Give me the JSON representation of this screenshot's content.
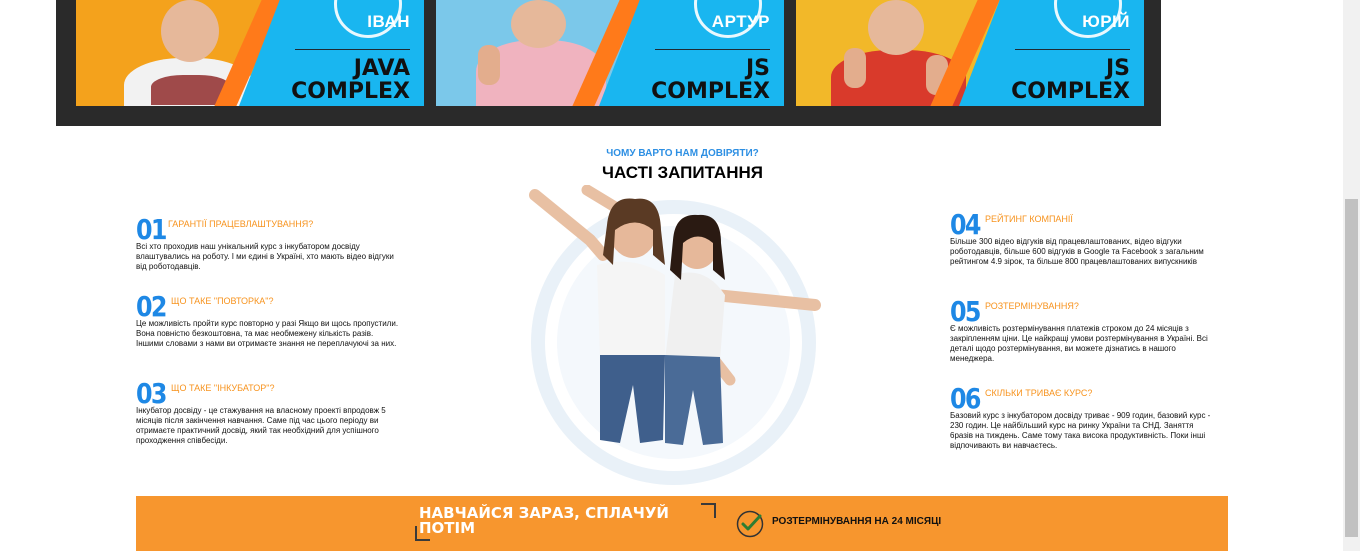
{
  "videos": [
    {
      "name": "ІВАН",
      "course_line1": "JAVA",
      "course_line2": "COMPLEX"
    },
    {
      "name": "АРТУР",
      "course_line1": "JS",
      "course_line2": "COMPLEX"
    },
    {
      "name": "ЮРІЙ",
      "course_line1": "JS",
      "course_line2": "COMPLEX"
    }
  ],
  "section": {
    "kicker": "ЧОМУ ВАРТО НАМ ДОВІРЯТИ?",
    "title": "ЧАСТІ ЗАПИТАННЯ"
  },
  "faq": [
    {
      "num": "01",
      "question": "ГАРАНТІЇ ПРАЦЕВЛАШТУВАННЯ?",
      "answer": "Всі хто проходив наш унікальний курс з інкубатором досвіду влаштувались на роботу. І ми єдині в Україні, хто мають відео відгуки від роботодавців."
    },
    {
      "num": "02",
      "question": "ЩО ТАКЕ \"ПОВТОРКА\"?",
      "answer": "Це можливість пройти курс повторно у разі Якщо ви щось пропустили. Вона повністю безкоштовна, та має необмежену кількість разів. Іншими словами з нами ви отримаєте знання не переплачуючі за них."
    },
    {
      "num": "03",
      "question": "ЩО ТАКЕ \"ІНКУБАТОР\"?",
      "answer": "Інкубатор досвіду - це стажування на власному проекті впродовж 5 місяців після закінчення навчання. Саме під час цього періоду ви отримаєте практичний досвід, який так необхідний для успішного проходження співбесіди."
    },
    {
      "num": "04",
      "question": "РЕЙТИНГ КОМПАНІЇ",
      "answer": "Більше 300 відео відгуків від працевлаштованих, відео відгуки роботодавців, більше 600 відгуків в Google та Facebook з загальним рейтингом 4.9 зірок, та більше 800 працевлаштованих випускників"
    },
    {
      "num": "05",
      "question": "РОЗТЕРМІНУВАННЯ?",
      "answer": "Є можливість розтермінування платежів строком до 24 місяців з закріпленням ціни. Це найкращі умови розтермінування в Україні. Всі деталі щодо розтермінування, ви можете дізнатись в нашого менеджера."
    },
    {
      "num": "06",
      "question": "СКІЛЬКИ ТРИВАЄ КУРС?",
      "answer": "Базовий курс з інкубатором досвіду триває - 909 годин, базовий курс - 230 годин. Це найбільший курс на ринку України та СНД. Заняття 6разів на тиждень. Саме тому така висока продуктивність. Поки інші відпочивають ви навчаєтесь."
    }
  ],
  "banner": {
    "cta": "НАВЧАЙСЯ ЗАРАЗ, СПЛАЧУЙ ПОТІМ",
    "installment": "РОЗТЕРМІНУВАННЯ НА 24 МІСЯЦІ"
  },
  "colors": {
    "accent_blue": "#1e88e5",
    "accent_orange": "#f7931e",
    "card_blue": "#19b6f0",
    "banner_orange": "#f7962e"
  }
}
